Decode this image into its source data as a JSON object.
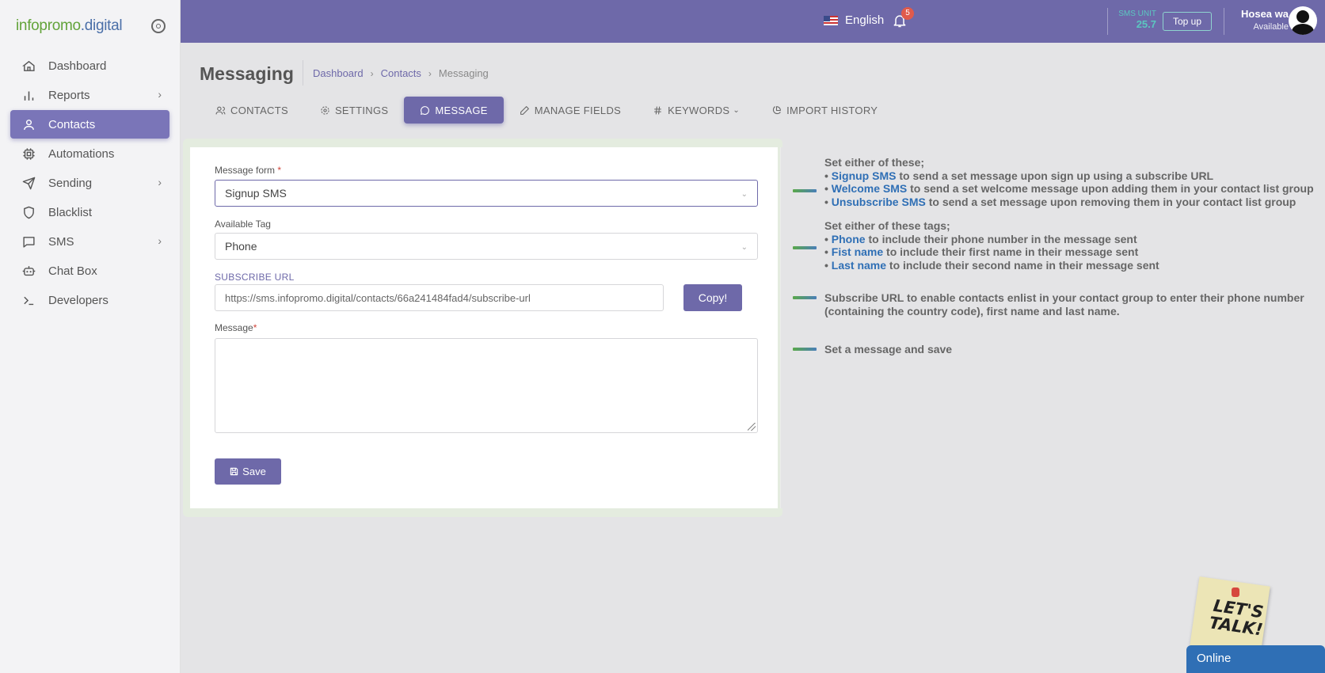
{
  "brand": {
    "part1": "infopromo",
    "part2": ".digital"
  },
  "sidebar": {
    "items": [
      {
        "label": "Dashboard"
      },
      {
        "label": "Reports"
      },
      {
        "label": "Contacts"
      },
      {
        "label": "Automations"
      },
      {
        "label": "Sending"
      },
      {
        "label": "Blacklist"
      },
      {
        "label": "SMS"
      },
      {
        "label": "Chat Box"
      },
      {
        "label": "Developers"
      }
    ]
  },
  "topbar": {
    "language": "English",
    "notification_count": "5",
    "sms_unit_label": "SMS UNIT",
    "sms_unit_value": "25.7",
    "topup_label": "Top up",
    "user_name": "Hosea wa",
    "user_status": "Available"
  },
  "page": {
    "title": "Messaging",
    "breadcrumb": [
      "Dashboard",
      "Contacts",
      "Messaging"
    ]
  },
  "tabs": [
    {
      "label": "CONTACTS"
    },
    {
      "label": "SETTINGS"
    },
    {
      "label": "MESSAGE"
    },
    {
      "label": "MANAGE FIELDS"
    },
    {
      "label": "KEYWORDS"
    },
    {
      "label": "IMPORT HISTORY"
    }
  ],
  "form": {
    "message_form_label": "Message form",
    "message_form_value": "Signup SMS",
    "available_tag_label": "Available Tag",
    "available_tag_value": "Phone",
    "subscribe_url_label": "SUBSCRIBE URL",
    "subscribe_url_value": "https://sms.infopromo.digital/contacts/66a241484fad4/subscribe-url",
    "copy_label": "Copy!",
    "message_label": "Message",
    "message_value": "",
    "save_label": "Save"
  },
  "help": {
    "block1": {
      "intro": "Set either of these;",
      "lines": [
        {
          "key": "Signup SMS",
          "text": " to send a set message upon sign up using a subscribe URL"
        },
        {
          "key": "Welcome SMS",
          "text": " to send a set welcome message upon adding them in your contact list group"
        },
        {
          "key": "Unsubscribe SMS",
          "text": " to send a set message upon removing them in your contact list group"
        }
      ]
    },
    "block2": {
      "intro": "Set either of these tags;",
      "lines": [
        {
          "key": "Phone",
          "text": " to include their phone number in the message sent"
        },
        {
          "key": "Fist name",
          "text": " to include their first name in their message sent"
        },
        {
          "key": "Last name",
          "text": " to include their second name in their message sent"
        }
      ]
    },
    "block3": "Subscribe URL to enable contacts enlist in your contact group to enter their phone number (containing the country code), first name and last name.",
    "block4": "Set a message and save"
  },
  "chat": {
    "note_line1": "LET'S",
    "note_line2": "TALK!",
    "status": "Online"
  }
}
